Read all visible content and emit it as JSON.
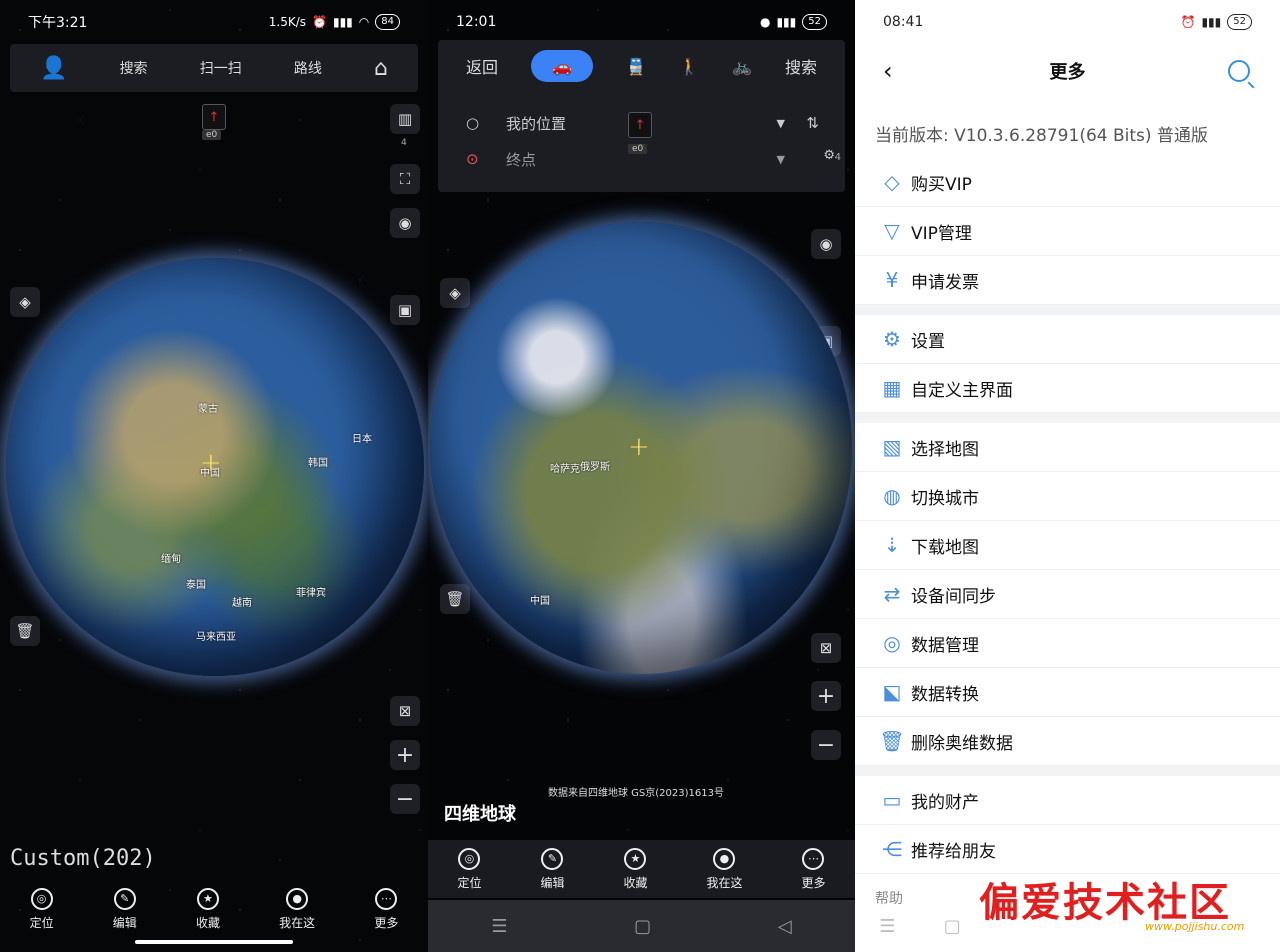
{
  "panel1": {
    "status": {
      "time": "下午3:21",
      "speed": "1.5K/s",
      "battery": "84"
    },
    "topbar": {
      "search": "搜索",
      "scan": "扫一扫",
      "route": "路线"
    },
    "side": {
      "layer_count": "4"
    },
    "compass_zoom": "e0",
    "globe_labels": [
      "蒙古",
      "中国",
      "日本",
      "韩国",
      "缅甸",
      "泰国",
      "越南",
      "菲律宾",
      "马来西亚"
    ],
    "custom_label": "Custom(202)",
    "nav": [
      {
        "label": "定位",
        "icon": "target-icon"
      },
      {
        "label": "编辑",
        "icon": "edit-icon"
      },
      {
        "label": "收藏",
        "icon": "star-icon"
      },
      {
        "label": "我在这",
        "icon": "pin-icon"
      },
      {
        "label": "更多",
        "icon": "more-icon"
      }
    ]
  },
  "panel2": {
    "status": {
      "time": "12:01",
      "battery": "52"
    },
    "routebar": {
      "back": "返回",
      "search": "搜索"
    },
    "route": {
      "start": "我的位置",
      "end": "终点"
    },
    "side": {
      "settings_count": "4"
    },
    "compass_zoom": "e0",
    "globe_labels": [
      "俄罗斯",
      "中国",
      "哈萨克"
    ],
    "credit": "数据来自四维地球 GS京(2023)1613号",
    "logo": "四维地球",
    "nav": [
      {
        "label": "定位",
        "icon": "target-icon"
      },
      {
        "label": "编辑",
        "icon": "edit-icon"
      },
      {
        "label": "收藏",
        "icon": "star-icon"
      },
      {
        "label": "我在这",
        "icon": "pin-icon"
      },
      {
        "label": "更多",
        "icon": "more-icon"
      }
    ]
  },
  "panel3": {
    "status": {
      "time": "08:41",
      "battery": "52"
    },
    "title": "更多",
    "version": "当前版本: V10.3.6.28791(64 Bits) 普通版",
    "groups": [
      [
        {
          "label": "购买VIP",
          "icon": "◇"
        },
        {
          "label": "VIP管理",
          "icon": "▽"
        },
        {
          "label": "申请发票",
          "icon": "¥"
        }
      ],
      [
        {
          "label": "设置",
          "icon": "⚙"
        },
        {
          "label": "自定义主界面",
          "icon": "▦"
        }
      ],
      [
        {
          "label": "选择地图",
          "icon": "▧"
        },
        {
          "label": "切换城市",
          "icon": "◍"
        },
        {
          "label": "下载地图",
          "icon": "⇣"
        },
        {
          "label": "设备间同步",
          "icon": "⇄"
        },
        {
          "label": "数据管理",
          "icon": "◎"
        },
        {
          "label": "数据转换",
          "icon": "⬕"
        },
        {
          "label": "删除奥维数据",
          "icon": "🗑"
        }
      ],
      [
        {
          "label": "我的财产",
          "icon": "▭"
        },
        {
          "label": "推荐给朋友",
          "icon": "⋲"
        }
      ]
    ],
    "help": "帮助",
    "watermark": "偏爱技术社区",
    "watermark_url": "www.pojjishu.com"
  }
}
